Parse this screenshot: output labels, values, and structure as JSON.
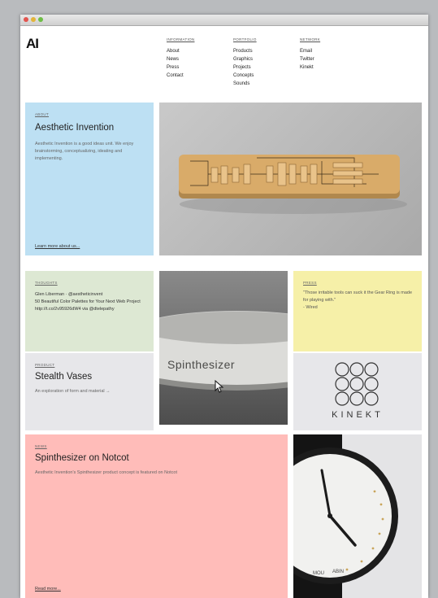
{
  "brand": {
    "logo": "AI"
  },
  "nav": {
    "information": {
      "heading": "INFORMATION",
      "items": [
        "About",
        "News",
        "Press",
        "Contact"
      ]
    },
    "portfolio": {
      "heading": "PORTFOLIO",
      "items": [
        "Products",
        "Graphics",
        "Projects",
        "Concepts",
        "Sounds"
      ]
    },
    "network": {
      "heading": "NETWORK",
      "items": [
        "Email",
        "Twitter",
        "Kinekt"
      ]
    }
  },
  "about": {
    "tag": "ABOUT",
    "title": "Aesthetic Invention",
    "body": "Aesthetic Invention is a good ideas unit. We enjoy brainstorming, conceptualizing, ideating and implementing.",
    "link": "Learn more about us..."
  },
  "thoughts": {
    "tag": "THOUGHTS",
    "line1": "Glen Liberman · @aestheticinvent",
    "line2": "50 Beautiful Color Palettes for Your Next Web Project http://t.co/2v95926dW4 via @dtelepathy"
  },
  "press": {
    "tag": "PRESS",
    "quote": "\"Those irritable tools can suck it the Gear Ring is made for playing with.\"",
    "source": "- Wired"
  },
  "product": {
    "tag": "PRODUCT",
    "title": "Stealth Vases",
    "body": "An exploration of form and material →"
  },
  "spinthesizer_image": {
    "label": "Spinthesizer"
  },
  "kinekt": {
    "wordmark": "KINEKT"
  },
  "news": {
    "tag": "NEWS",
    "title": "Spinthesizer on Notcot",
    "body": "Aesthetic Invention's Spinthesizer product concept is featured on Notcot",
    "link": "Read more..."
  },
  "colors": {
    "about_bg": "#bde0f3",
    "thoughts_bg": "#dde8d3",
    "press_bg": "#f6f0a8",
    "product_bg": "#e7e7ea",
    "news_bg": "#ffbcb9"
  }
}
